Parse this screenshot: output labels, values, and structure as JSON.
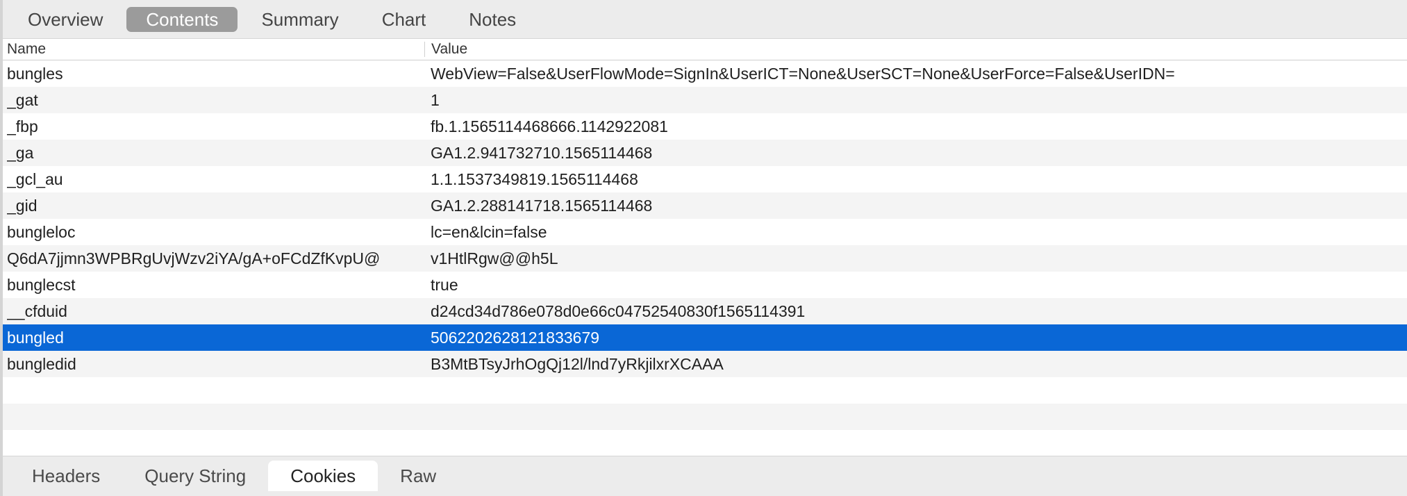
{
  "top_tabs": [
    {
      "label": "Overview",
      "active": false
    },
    {
      "label": "Contents",
      "active": true
    },
    {
      "label": "Summary",
      "active": false
    },
    {
      "label": "Chart",
      "active": false
    },
    {
      "label": "Notes",
      "active": false
    }
  ],
  "table": {
    "columns": {
      "name": "Name",
      "value": "Value"
    },
    "rows": [
      {
        "name": "bungles",
        "value": "WebView=False&UserFlowMode=SignIn&UserICT=None&UserSCT=None&UserForce=False&UserIDN="
      },
      {
        "name": "_gat",
        "value": "1"
      },
      {
        "name": "_fbp",
        "value": "fb.1.1565114468666.1142922081"
      },
      {
        "name": "_ga",
        "value": "GA1.2.941732710.1565114468"
      },
      {
        "name": "_gcl_au",
        "value": "1.1.1537349819.1565114468"
      },
      {
        "name": "_gid",
        "value": "GA1.2.288141718.1565114468"
      },
      {
        "name": "bungleloc",
        "value": "lc=en&lcin=false"
      },
      {
        "name": "Q6dA7jjmn3WPBRgUvjWzv2iYA/gA+oFCdZfKvpU@",
        "value": "v1HtlRgw@@h5L"
      },
      {
        "name": "bunglecst",
        "value": "true"
      },
      {
        "name": "__cfduid",
        "value": "d24cd34d786e078d0e66c04752540830f1565114391"
      },
      {
        "name": "bungled",
        "value": "5062202628121833679",
        "selected": true
      },
      {
        "name": "bungledid",
        "value": "B3MtBTsyJrhOgQj12l/lnd7yRkjilxrXCAAA"
      }
    ]
  },
  "bottom_tabs": [
    {
      "label": "Headers",
      "active": false
    },
    {
      "label": "Query String",
      "active": false
    },
    {
      "label": "Cookies",
      "active": true
    },
    {
      "label": "Raw",
      "active": false
    }
  ],
  "colors": {
    "selection": "#0a67d6",
    "active_top_tab": "#9b9b9b",
    "bar_background": "#ececec"
  }
}
